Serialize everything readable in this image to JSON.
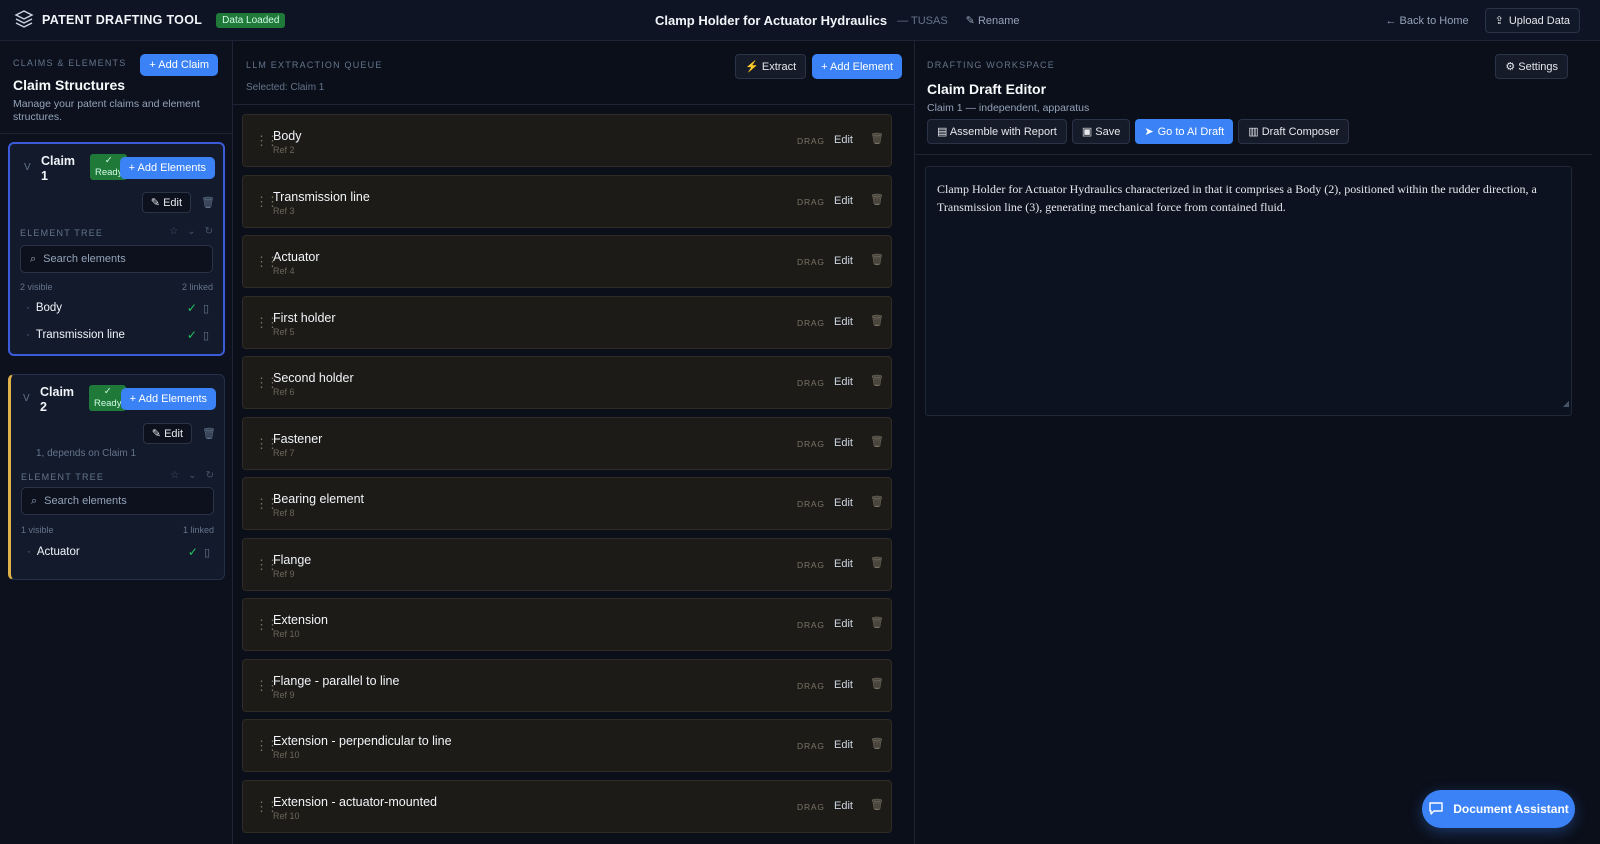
{
  "header": {
    "app_name": "PATENT DRAFTING TOOL",
    "status_badge": "Data Loaded",
    "doc_title": "Clamp Holder for Actuator Hydraulics",
    "doc_owner": "— TUSAS",
    "rename": "Rename",
    "back": "Back to Home",
    "upload": "Upload Data"
  },
  "left": {
    "section": "CLAIMS & ELEMENTS",
    "add_claim": "+ Add Claim",
    "title": "Claim Structures",
    "desc": "Manage your patent claims and element structures.",
    "claims": [
      {
        "name": "Claim 1",
        "status": "Ready",
        "add_elements": "+ Add Elements",
        "edit": "Edit",
        "tree_label": "ELEMENT TREE",
        "search_placeholder": "Search elements",
        "visible": "2 visible",
        "linked": "2 linked",
        "items": [
          "Body",
          "Transmission line"
        ]
      },
      {
        "name": "Claim 2",
        "status": "Ready",
        "add_elements": "+ Add Elements",
        "edit": "Edit",
        "depends": "1, depends on Claim 1",
        "tree_label": "ELEMENT TREE",
        "search_placeholder": "Search elements",
        "visible": "1 visible",
        "linked": "1 linked",
        "items": [
          "Actuator"
        ]
      }
    ]
  },
  "queue": {
    "section": "LLM EXTRACTION QUEUE",
    "selected": "Selected: Claim 1",
    "extract": "Extract",
    "add_element": "+ Add Element",
    "drag": "DRAG",
    "edit": "Edit",
    "items": [
      {
        "name": "Body",
        "ref": "Ref 2"
      },
      {
        "name": "Transmission line",
        "ref": "Ref 3"
      },
      {
        "name": "Actuator",
        "ref": "Ref 4"
      },
      {
        "name": "First holder",
        "ref": "Ref 5"
      },
      {
        "name": "Second holder",
        "ref": "Ref 6"
      },
      {
        "name": "Fastener",
        "ref": "Ref 7"
      },
      {
        "name": "Bearing element",
        "ref": "Ref 8"
      },
      {
        "name": "Flange",
        "ref": "Ref 9"
      },
      {
        "name": "Extension",
        "ref": "Ref 10"
      },
      {
        "name": "Flange - parallel to line",
        "ref": "Ref 9"
      },
      {
        "name": "Extension - perpendicular to line",
        "ref": "Ref 10"
      },
      {
        "name": "Extension - actuator-mounted",
        "ref": "Ref 10"
      }
    ]
  },
  "workspace": {
    "section": "DRAFTING WORKSPACE",
    "settings": "Settings",
    "title": "Claim Draft Editor",
    "subtitle": "Claim 1 — independent, apparatus",
    "assemble": "Assemble with Report",
    "save": "Save",
    "go_ai": "Go to AI Draft",
    "composer": "Draft Composer",
    "draft_text": "Clamp Holder for Actuator Hydraulics characterized in that it comprises a Body (2), positioned within the rudder direction, a Transmission line (3), generating mechanical force from contained fluid."
  },
  "assistant": {
    "label": "Document Assistant"
  },
  "colors": {
    "accent": "#3b82f6",
    "success": "#1f7a3a",
    "claim2_accent": "#e0b24a"
  }
}
